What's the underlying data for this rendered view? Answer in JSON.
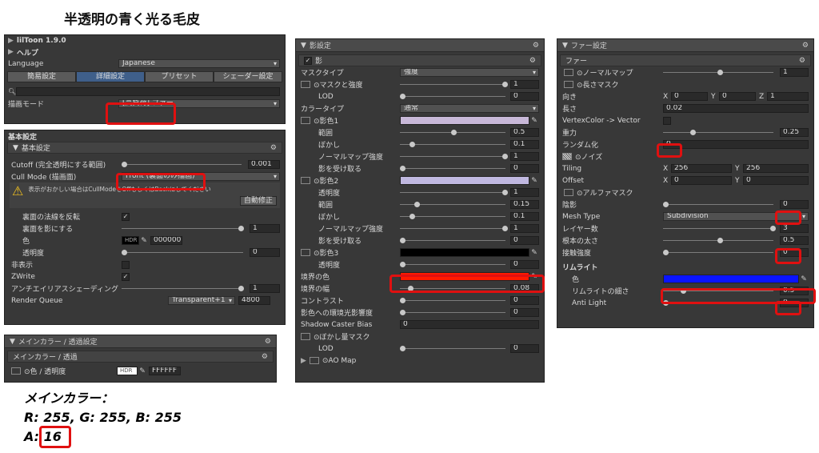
{
  "title": "半透明の青く光る毛皮",
  "lil": {
    "header": "lilToon 1.9.0",
    "help": "ヘルプ",
    "language_label": "Language",
    "language_value": "Japanese",
    "tabs": [
      "簡易設定",
      "詳細設定",
      "プリセット",
      "シェーダー設定"
    ],
    "render_mode_label": "描画モード",
    "render_mode_value": "[高負荷] ファー"
  },
  "basic": {
    "section": "基本設定",
    "sub": "基本設定",
    "cutoff_label": "Cutoff (完全透明にする範囲)",
    "cutoff_value": "0.001",
    "cull_label": "Cull Mode (描画面)",
    "cull_value": "Front (裏面のみ描画)",
    "warning": "表示がおかしい場合はCullModeをOffもしくはBackにしてください",
    "fix_button": "自動修正",
    "flip_normal_label": "裏面の法線を反転",
    "back_shadow_label": "裏面を影にする",
    "back_shadow_value": "1",
    "color_label": "色",
    "hdr": "HDR",
    "color_value": "000000",
    "transparency_label": "透明度",
    "transparency_value": "0",
    "hidden_label": "非表示",
    "zwrite_label": "ZWrite",
    "aa_label": "アンチエイリアスシェーディング",
    "aa_value": "1",
    "render_queue_label": "Render Queue",
    "render_queue_mode": "Transparent+1",
    "render_queue_value": "4800"
  },
  "main_color": {
    "header": "メインカラー / 透過設定",
    "sub": "メインカラー / 透過",
    "label": "⊙色 / 透明度",
    "hdr": "HDR",
    "value": "FFFFFF"
  },
  "note": {
    "line1": "メインカラー：",
    "line2": "R: 255, G: 255, B: 255",
    "line3_prefix": "A:",
    "line3_value": "16"
  },
  "shadow": {
    "header": "影設定",
    "sub": "影",
    "mask_type_label": "マスクタイプ",
    "mask_type_value": "強度",
    "mask_strength_label": "⊙マスクと強度",
    "mask_strength_value": "1",
    "lod_label": "LOD",
    "lod_value": "0",
    "color_type_label": "カラータイプ",
    "color_type_value": "通常",
    "shadow1_label": "⊙影色1",
    "range_label": "範囲",
    "s1_range": "0.5",
    "blur_label": "ぼかし",
    "s1_blur": "0.1",
    "normal_label": "ノーマルマップ強度",
    "s1_normal": "1",
    "receive_label": "影を受け取る",
    "s1_receive": "0",
    "shadow2_label": "⊙影色2",
    "transparency_label": "透明度",
    "s2_trans": "1",
    "s2_range": "0.15",
    "s2_blur": "0.1",
    "s2_normal": "1",
    "s2_receive": "0",
    "shadow3_label": "⊙影色3",
    "s3_trans": "0",
    "border_color_label": "境界の色",
    "border_color": "#ff1a00",
    "border_width_label": "境界の幅",
    "border_width_value": "0.08",
    "contrast_label": "コントラスト",
    "contrast_value": "0",
    "env_label": "影色への環境光影響度",
    "env_value": "0",
    "caster_label": "Shadow Caster Bias",
    "caster_value": "0",
    "blur_mask_label": "⊙ぼかし量マスク",
    "lod2_label": "LOD",
    "lod2_value": "0",
    "ao_label": "⊙AO Map"
  },
  "fur": {
    "header": "ファー設定",
    "sub": "ファー",
    "normal_map_label": "⊙ノーマルマップ",
    "normal_map_value": "1",
    "length_mask_label": "⊙長さマスク",
    "direction_label": "向き",
    "dir_x_label": "X",
    "dir_x": "0",
    "dir_y_label": "Y",
    "dir_y": "0",
    "dir_z_label": "Z",
    "dir_z": "1",
    "length_label": "長さ",
    "length_value": "0.02",
    "vc_label": "VertexColor -> Vector",
    "gravity_label": "重力",
    "gravity_value": "0.25",
    "random_label": "ランダム化",
    "random_value": "0",
    "noise_label": "⊙ノイズ",
    "tiling_label": "Tiling",
    "tiling_x_label": "X",
    "tiling_x": "256",
    "tiling_y_label": "Y",
    "tiling_y": "256",
    "offset_label": "Offset",
    "offset_x_label": "X",
    "offset_x": "0",
    "offset_y_label": "Y",
    "offset_y": "0",
    "alpha_mask_label": "⊙アルファマスク",
    "shadow_label": "陰影",
    "shadow_value": "0",
    "mesh_type_label": "Mesh Type",
    "mesh_type_value": "Subdivision",
    "layers_label": "レイヤー数",
    "layers_value": "3",
    "root_label": "根本の太さ",
    "root_value": "0.5",
    "touch_label": "接触強度",
    "touch_value": "0",
    "rim_section": "リムライト",
    "rim_color_label": "色",
    "rim_color": "#0a14ff",
    "rim_width_label": "リムライトの細さ",
    "rim_width_value": "0.5",
    "anti_light_label": "Anti Light",
    "anti_light_value": "0"
  }
}
